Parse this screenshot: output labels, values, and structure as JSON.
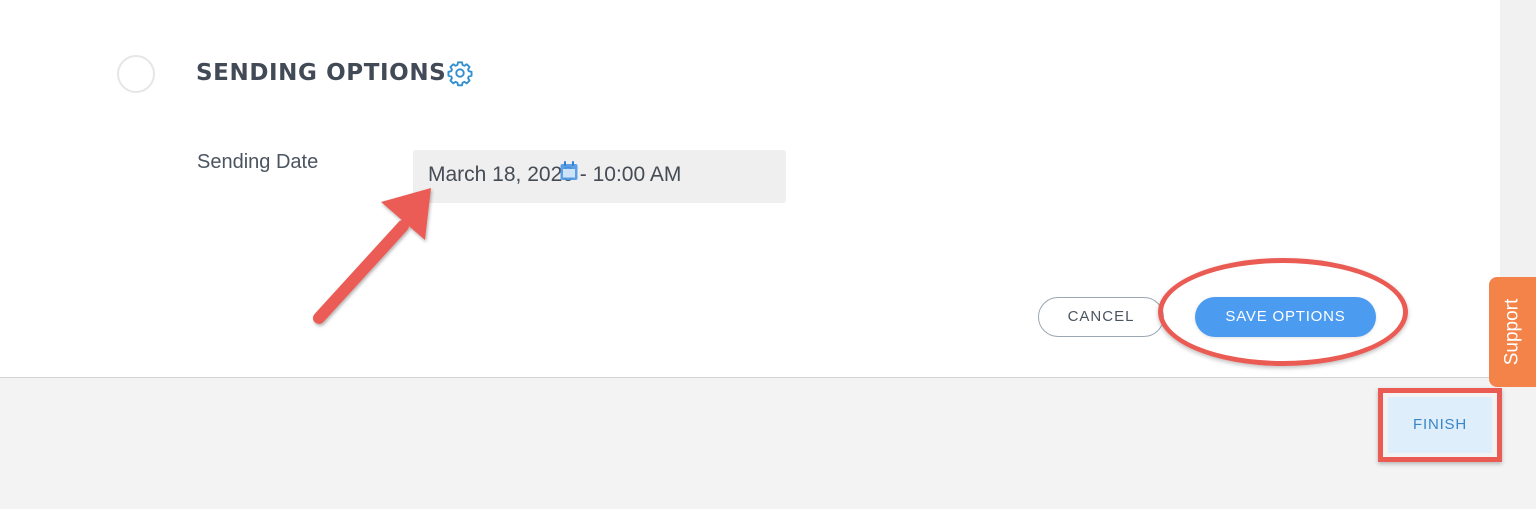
{
  "section": {
    "title": "SENDING OPTIONS",
    "settings_icon": "gear-icon"
  },
  "form": {
    "sending_date_label": "Sending Date",
    "sending_date_value": "March 18, 2020 - 10:00 AM",
    "date_icon": "calendar-icon"
  },
  "actions": {
    "cancel_label": "CANCEL",
    "save_label": "SAVE OPTIONS"
  },
  "footer": {
    "finish_label": "FINISH"
  },
  "support": {
    "label": "Support"
  },
  "colors": {
    "accent": "#4b9bf0",
    "annotation": "#ea5b54",
    "support": "#f4834a",
    "finish_bg": "#deeefb"
  }
}
